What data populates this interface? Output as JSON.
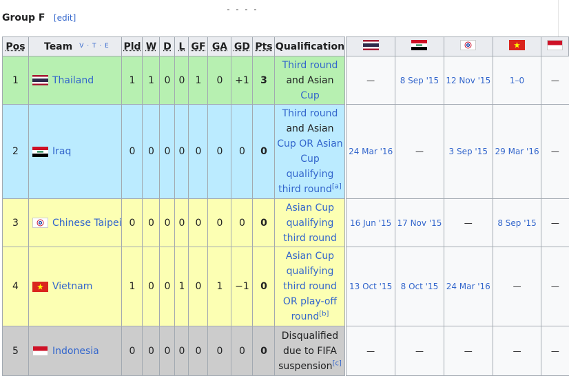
{
  "group": {
    "title": "Group F",
    "edit_label": "[edit]"
  },
  "vte_label": "V · T · E",
  "columns": {
    "pos": "Pos",
    "team": "Team",
    "pld": "Pld",
    "w": "W",
    "d": "D",
    "l": "L",
    "gf": "GF",
    "ga": "GA",
    "gd": "GD",
    "pts": "Pts",
    "qualification": "Qualification"
  },
  "teams": [
    {
      "pos": "1",
      "name": "Thailand",
      "pld": "1",
      "w": "1",
      "d": "0",
      "l": "0",
      "gf": "1",
      "ga": "0",
      "gd": "+1",
      "pts": "3",
      "qual_lines": [
        "Third round",
        "and Asian",
        "Cup"
      ],
      "flag": "thailand-flag-icon",
      "results": [
        "—",
        "8 Sep '15",
        "12 Nov '15",
        "1–0",
        "—"
      ]
    },
    {
      "pos": "2",
      "name": "Iraq",
      "pld": "0",
      "w": "0",
      "d": "0",
      "l": "0",
      "gf": "0",
      "ga": "0",
      "gd": "0",
      "pts": "0",
      "qual_lines": [
        "Third round",
        "and Asian",
        "Cup OR Asian",
        "Cup",
        "qualifying",
        "third round"
      ],
      "qual_note": "[a]",
      "flag": "iraq-flag-icon",
      "results": [
        "24 Mar '16",
        "—",
        "3 Sep '15",
        "29 Mar '16",
        "—"
      ]
    },
    {
      "pos": "3",
      "name": "Chinese Taipei",
      "pld": "0",
      "w": "0",
      "d": "0",
      "l": "0",
      "gf": "0",
      "ga": "0",
      "gd": "0",
      "pts": "0",
      "qual_lines": [
        "Asian Cup",
        "qualifying",
        "third round"
      ],
      "flag": "chinese-taipei-flag-icon",
      "results": [
        "16 Jun '15",
        "17 Nov '15",
        "—",
        "8 Sep '15",
        "—"
      ]
    },
    {
      "pos": "4",
      "name": "Vietnam",
      "pld": "1",
      "w": "0",
      "d": "0",
      "l": "1",
      "gf": "0",
      "ga": "1",
      "gd": "−1",
      "pts": "0",
      "qual_lines": [
        "Asian Cup",
        "qualifying",
        "third round",
        "OR play-off",
        "round"
      ],
      "qual_note": "[b]",
      "flag": "vietnam-flag-icon",
      "results": [
        "13 Oct '15",
        "8 Oct '15",
        "24 Mar '16",
        "—",
        "—"
      ]
    },
    {
      "pos": "5",
      "name": "Indonesia",
      "pld": "0",
      "w": "0",
      "d": "0",
      "l": "0",
      "gf": "0",
      "ga": "0",
      "gd": "0",
      "pts": "0",
      "qual_lines": [
        "Disqualified",
        "due to FIFA",
        "suspension"
      ],
      "qual_note": "[c]",
      "flag": "indonesia-flag-icon",
      "results": [
        "—",
        "—",
        "—",
        "—",
        "—"
      ]
    }
  ],
  "colors": {
    "row_green": "#b7f0b1",
    "row_blue": "#bbebff",
    "row_yellow": "#fcffb3",
    "row_gray": "#cccccc",
    "link": "#3366cc",
    "header": "#eaecf0"
  }
}
